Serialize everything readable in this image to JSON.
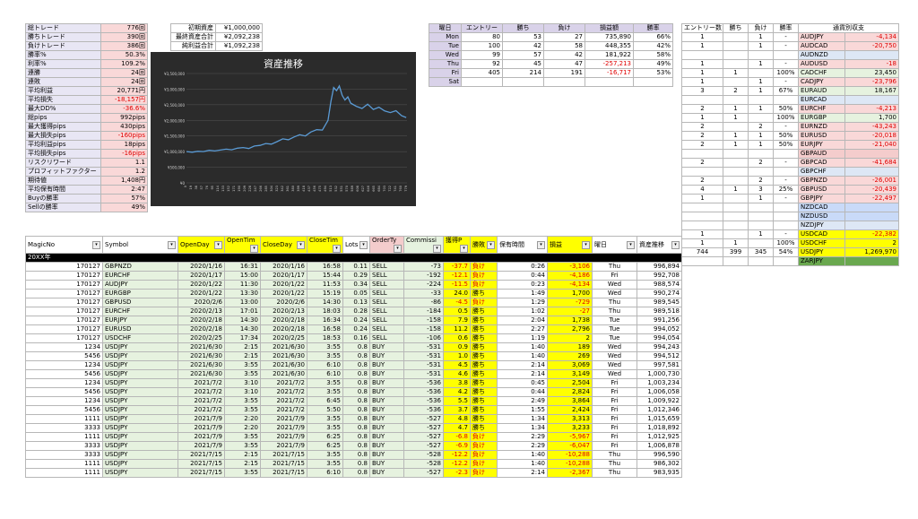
{
  "stats": [
    {
      "label": "総トレード",
      "value": "776回"
    },
    {
      "label": "勝ちトレード",
      "value": "390回"
    },
    {
      "label": "負けトレード",
      "value": "386回"
    },
    {
      "label": "勝率%",
      "value": "50.3%"
    },
    {
      "label": "利率%",
      "value": "109.2%"
    },
    {
      "label": "連勝",
      "value": "24回"
    },
    {
      "label": "連敗",
      "value": "24回"
    },
    {
      "label": "平均利益",
      "value": "20,771円"
    },
    {
      "label": "平均損失",
      "value": "-18,157円",
      "neg": true
    },
    {
      "label": "最大DD%",
      "value": "-36.6%",
      "neg": true
    },
    {
      "label": "総pips",
      "value": "992pips"
    },
    {
      "label": "最大獲得pips",
      "value": "430pips"
    },
    {
      "label": "最大損失pips",
      "value": "-160pips",
      "neg": true
    },
    {
      "label": "平均利益pips",
      "value": "18pips"
    },
    {
      "label": "平均損失pips",
      "value": "-16pips",
      "neg": true
    },
    {
      "label": "リスクリワード",
      "value": "1.1"
    },
    {
      "label": "プロフィットファクター",
      "value": "1.2"
    },
    {
      "label": "期待値",
      "value": "1,408円"
    },
    {
      "label": "平均保有時間",
      "value": "2:47"
    },
    {
      "label": "Buyの勝率",
      "value": "57%"
    },
    {
      "label": "Sellの勝率",
      "value": "49%"
    }
  ],
  "capital": [
    {
      "label": "初期資産",
      "value": "¥1,000,000"
    },
    {
      "label": "最終資産合計",
      "value": "¥2,092,238"
    },
    {
      "label": "純利益合計",
      "value": "¥1,092,238"
    }
  ],
  "chart_data": {
    "type": "line",
    "title": "資産推移",
    "ylim": [
      0,
      3500000
    ],
    "yticks": [
      "¥3,500,000",
      "¥3,000,000",
      "¥2,500,000",
      "¥2,000,000",
      "¥1,500,000",
      "¥1,000,000",
      "¥500,000",
      "¥0"
    ],
    "xticks": [
      "0",
      "19",
      "38",
      "57",
      "76",
      "95",
      "114",
      "133",
      "152",
      "171",
      "190",
      "209",
      "228",
      "247",
      "266",
      "285",
      "304",
      "323",
      "342",
      "361",
      "380",
      "399",
      "418",
      "437",
      "456",
      "475",
      "494",
      "513",
      "532",
      "551",
      "570",
      "589",
      "608",
      "627",
      "646",
      "665",
      "684",
      "703",
      "722",
      "741",
      "760",
      "779"
    ],
    "series": [
      {
        "x": [
          0,
          20,
          40,
          60,
          80,
          100,
          120,
          140,
          160,
          180,
          200,
          220,
          240,
          260,
          280,
          300,
          320,
          340,
          360,
          380,
          400,
          420,
          440,
          460,
          480,
          500,
          510,
          520,
          530,
          540,
          550,
          560,
          570,
          580,
          600,
          620,
          640,
          660,
          680,
          700,
          720,
          740,
          760,
          776
        ],
        "values": [
          1000000,
          980000,
          1010000,
          1000000,
          1040000,
          1020000,
          1050000,
          1080000,
          1060000,
          1110000,
          1130000,
          1100000,
          1180000,
          1200000,
          1260000,
          1240000,
          1320000,
          1410000,
          1380000,
          1470000,
          1540000,
          1500000,
          1630000,
          1700000,
          1690000,
          2000000,
          2600000,
          3050000,
          2950000,
          3100000,
          2800000,
          2650000,
          2750000,
          2550000,
          2450000,
          2380000,
          2520000,
          2350000,
          2420000,
          2300000,
          2250000,
          2310000,
          2150000,
          2092238
        ]
      }
    ]
  },
  "weekday": {
    "headers": [
      "曜日",
      "エントリー",
      "勝ち",
      "負け",
      "損益額",
      "勝率"
    ],
    "rows": [
      [
        "Mon",
        "80",
        "53",
        "27",
        "735,890",
        "66%"
      ],
      [
        "Tue",
        "100",
        "42",
        "58",
        "448,355",
        "42%"
      ],
      [
        "Wed",
        "99",
        "57",
        "42",
        "181,922",
        "58%"
      ],
      [
        "Thu",
        "92",
        "45",
        "47",
        "-257,213",
        "49%"
      ],
      [
        "Fri",
        "405",
        "214",
        "191",
        "-16,717",
        "53%"
      ],
      [
        "Sat",
        "",
        "",
        "",
        "",
        ""
      ]
    ]
  },
  "currency": {
    "headers": [
      "エントリー数",
      "勝ち",
      "負け",
      "勝率",
      "通貨別収支"
    ],
    "rows": [
      [
        "1",
        "",
        "1",
        "-",
        "AUDJPY",
        "-4,134",
        "pink"
      ],
      [
        "1",
        "",
        "1",
        "-",
        "AUDCAD",
        "-20,750",
        "pink"
      ],
      [
        "",
        "",
        "",
        "",
        "AUDNZD",
        "",
        "blu"
      ],
      [
        "1",
        "",
        "1",
        "-",
        "AUDUSD",
        "-18",
        "pink"
      ],
      [
        "1",
        "1",
        "",
        "100%",
        "CADCHF",
        "23,450",
        "grn"
      ],
      [
        "1",
        "",
        "1",
        "-",
        "CADJPY",
        "-23,796",
        "pink"
      ],
      [
        "3",
        "2",
        "1",
        "67%",
        "EURAUD",
        "18,167",
        "grn"
      ],
      [
        "",
        "",
        "",
        "",
        "EURCAD",
        "",
        "blu"
      ],
      [
        "2",
        "1",
        "1",
        "50%",
        "EURCHF",
        "-4,213",
        "pink"
      ],
      [
        "1",
        "1",
        "",
        "100%",
        "EURGBP",
        "1,700",
        "grn"
      ],
      [
        "2",
        "",
        "2",
        "-",
        "EURNZD",
        "-43,243",
        "pink"
      ],
      [
        "2",
        "1",
        "1",
        "50%",
        "EURUSD",
        "-20,018",
        "pink"
      ],
      [
        "2",
        "1",
        "1",
        "50%",
        "EURJPY",
        "-21,040",
        "pink"
      ],
      [
        "",
        "",
        "",
        "",
        "GBPAUD",
        "",
        "ltp"
      ],
      [
        "2",
        "",
        "2",
        "-",
        "GBPCAD",
        "-41,684",
        "pink"
      ],
      [
        "",
        "",
        "",
        "",
        "GBPCHF",
        "",
        "blu"
      ],
      [
        "2",
        "",
        "2",
        "-",
        "GBPNZD",
        "-26,001",
        "pink"
      ],
      [
        "4",
        "1",
        "3",
        "25%",
        "GBPUSD",
        "-20,439",
        "pink"
      ],
      [
        "1",
        "",
        "1",
        "-",
        "GBPJPY",
        "-22,497",
        "pink"
      ],
      [
        "",
        "",
        "",
        "",
        "NZDCAD",
        "",
        "ltb"
      ],
      [
        "",
        "",
        "",
        "",
        "NZDUSD",
        "",
        "ltb"
      ],
      [
        "",
        "",
        "",
        "",
        "NZDJPY",
        "",
        "blu"
      ],
      [
        "1",
        "",
        "1",
        "-",
        "USDCAD",
        "-22,382",
        "yel"
      ],
      [
        "1",
        "1",
        "",
        "100%",
        "USDCHF",
        "2",
        "yel"
      ],
      [
        "744",
        "399",
        "345",
        "54%",
        "USDJPY",
        "1,269,970",
        "yel"
      ],
      [
        "",
        "",
        "",
        "",
        "ZARJPY",
        "",
        "gr2"
      ]
    ]
  },
  "trades": {
    "headers": [
      "MagicNo",
      "Symbol",
      "OpenDay",
      "OpenTim",
      "CloseDay",
      "CloseTim",
      "Lots",
      "OrderTy",
      "Commissi",
      "獲得P",
      "勝敗",
      "保有時間",
      "損益",
      "曜日",
      "資産推移"
    ],
    "group": "20XX年",
    "rows": [
      [
        "170127",
        "GBPNZD",
        "2020/1/16",
        "16:31",
        "2020/1/16",
        "16:58",
        "0.11",
        "SELL",
        "-73",
        "-37.7",
        "負け",
        "0:26",
        "-3,106",
        "Thu",
        "996,894"
      ],
      [
        "170127",
        "EURCHF",
        "2020/1/17",
        "15:00",
        "2020/1/17",
        "15:44",
        "0.29",
        "SELL",
        "-192",
        "-12.1",
        "負け",
        "0:44",
        "-4,186",
        "Fri",
        "992,708"
      ],
      [
        "170127",
        "AUDJPY",
        "2020/1/22",
        "11:30",
        "2020/1/22",
        "11:53",
        "0.34",
        "SELL",
        "-224",
        "-11.5",
        "負け",
        "0:23",
        "-4,134",
        "Wed",
        "988,574"
      ],
      [
        "170127",
        "EURGBP",
        "2020/1/22",
        "13:30",
        "2020/1/22",
        "15:19",
        "0.05",
        "SELL",
        "-33",
        "24.0",
        "勝ち",
        "1:49",
        "1,700",
        "Wed",
        "990,274"
      ],
      [
        "170127",
        "GBPUSD",
        "2020/2/6",
        "13:00",
        "2020/2/6",
        "14:30",
        "0.13",
        "SELL",
        "-86",
        "-4.5",
        "負け",
        "1:29",
        "-729",
        "Thu",
        "989,545"
      ],
      [
        "170127",
        "EURCHF",
        "2020/2/13",
        "17:01",
        "2020/2/13",
        "18:03",
        "0.28",
        "SELL",
        "-184",
        "0.5",
        "勝ち",
        "1:02",
        "-27",
        "Thu",
        "989,518"
      ],
      [
        "170127",
        "EURJPY",
        "2020/2/18",
        "14:30",
        "2020/2/18",
        "16:34",
        "0.24",
        "SELL",
        "-158",
        "7.9",
        "勝ち",
        "2:04",
        "1,738",
        "Tue",
        "991,256"
      ],
      [
        "170127",
        "EURUSD",
        "2020/2/18",
        "14:30",
        "2020/2/18",
        "16:58",
        "0.24",
        "SELL",
        "-158",
        "11.2",
        "勝ち",
        "2:27",
        "2,796",
        "Tue",
        "994,052"
      ],
      [
        "170127",
        "USDCHF",
        "2020/2/25",
        "17:34",
        "2020/2/25",
        "18:53",
        "0.16",
        "SELL",
        "-106",
        "0.6",
        "勝ち",
        "1:19",
        "2",
        "Tue",
        "994,054"
      ],
      [
        "1234",
        "USDJPY",
        "2021/6/30",
        "2:15",
        "2021/6/30",
        "3:55",
        "0.8",
        "BUY",
        "-531",
        "0.9",
        "勝ち",
        "1:40",
        "189",
        "Wed",
        "994,243"
      ],
      [
        "5456",
        "USDJPY",
        "2021/6/30",
        "2:15",
        "2021/6/30",
        "3:55",
        "0.8",
        "BUY",
        "-531",
        "1.0",
        "勝ち",
        "1:40",
        "269",
        "Wed",
        "994,512"
      ],
      [
        "1234",
        "USDJPY",
        "2021/6/30",
        "3:55",
        "2021/6/30",
        "6:10",
        "0.8",
        "BUY",
        "-531",
        "4.5",
        "勝ち",
        "2:14",
        "3,069",
        "Wed",
        "997,581"
      ],
      [
        "5456",
        "USDJPY",
        "2021/6/30",
        "3:55",
        "2021/6/30",
        "6:10",
        "0.8",
        "BUY",
        "-531",
        "4.6",
        "勝ち",
        "2:14",
        "3,149",
        "Wed",
        "1,000,730"
      ],
      [
        "1234",
        "USDJPY",
        "2021/7/2",
        "3:10",
        "2021/7/2",
        "3:55",
        "0.8",
        "BUY",
        "-536",
        "3.8",
        "勝ち",
        "0:45",
        "2,504",
        "Fri",
        "1,003,234"
      ],
      [
        "5456",
        "USDJPY",
        "2021/7/2",
        "3:10",
        "2021/7/2",
        "3:55",
        "0.8",
        "BUY",
        "-536",
        "4.2",
        "勝ち",
        "0:44",
        "2,824",
        "Fri",
        "1,006,058"
      ],
      [
        "1234",
        "USDJPY",
        "2021/7/2",
        "3:55",
        "2021/7/2",
        "6:45",
        "0.8",
        "BUY",
        "-536",
        "5.5",
        "勝ち",
        "2:49",
        "3,864",
        "Fri",
        "1,009,922"
      ],
      [
        "5456",
        "USDJPY",
        "2021/7/2",
        "3:55",
        "2021/7/2",
        "5:50",
        "0.8",
        "BUY",
        "-536",
        "3.7",
        "勝ち",
        "1:55",
        "2,424",
        "Fri",
        "1,012,346"
      ],
      [
        "1111",
        "USDJPY",
        "2021/7/9",
        "2:20",
        "2021/7/9",
        "3:55",
        "0.8",
        "BUY",
        "-527",
        "4.8",
        "勝ち",
        "1:34",
        "3,313",
        "Fri",
        "1,015,659"
      ],
      [
        "3333",
        "USDJPY",
        "2021/7/9",
        "2:20",
        "2021/7/9",
        "3:55",
        "0.8",
        "BUY",
        "-527",
        "4.7",
        "勝ち",
        "1:34",
        "3,233",
        "Fri",
        "1,018,892"
      ],
      [
        "1111",
        "USDJPY",
        "2021/7/9",
        "3:55",
        "2021/7/9",
        "6:25",
        "0.8",
        "BUY",
        "-527",
        "-6.8",
        "負け",
        "2:29",
        "-5,967",
        "Fri",
        "1,012,925"
      ],
      [
        "3333",
        "USDJPY",
        "2021/7/9",
        "3:55",
        "2021/7/9",
        "6:25",
        "0.8",
        "BUY",
        "-527",
        "-6.9",
        "負け",
        "2:29",
        "-6,047",
        "Fri",
        "1,006,878"
      ],
      [
        "3333",
        "USDJPY",
        "2021/7/15",
        "2:15",
        "2021/7/15",
        "3:55",
        "0.8",
        "BUY",
        "-528",
        "-12.2",
        "負け",
        "1:40",
        "-10,288",
        "Thu",
        "996,590"
      ],
      [
        "1111",
        "USDJPY",
        "2021/7/15",
        "2:15",
        "2021/7/15",
        "3:55",
        "0.8",
        "BUY",
        "-528",
        "-12.2",
        "負け",
        "1:40",
        "-10,288",
        "Thu",
        "986,302"
      ],
      [
        "1111",
        "USDJPY",
        "2021/7/15",
        "3:55",
        "2021/7/15",
        "6:10",
        "0.8",
        "BUY",
        "-527",
        "-2.3",
        "負け",
        "2:14",
        "-2,367",
        "Thu",
        "983,935"
      ]
    ]
  }
}
